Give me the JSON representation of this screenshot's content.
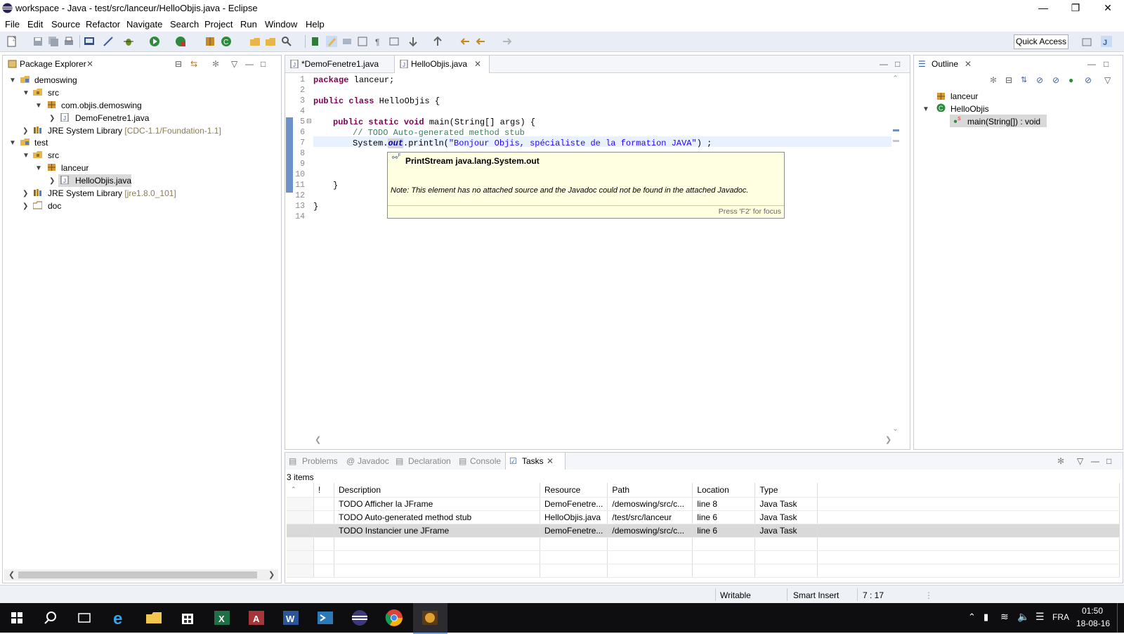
{
  "window": {
    "title": "workspace - Java - test/src/lanceur/HelloObjis.java - Eclipse"
  },
  "menubar": [
    "File",
    "Edit",
    "Source",
    "Refactor",
    "Navigate",
    "Search",
    "Project",
    "Run",
    "Window",
    "Help"
  ],
  "toolbar": {
    "quick_access": "Quick Access"
  },
  "package_explorer": {
    "title": "Package Explorer",
    "nodes": [
      {
        "label": "demoswing"
      },
      {
        "label": "src"
      },
      {
        "label": "com.objis.demoswing"
      },
      {
        "label": "DemoFenetre1.java"
      },
      {
        "label": "JRE System Library",
        "suffix": "[CDC-1.1/Foundation-1.1]"
      },
      {
        "label": "test"
      },
      {
        "label": "src"
      },
      {
        "label": "lanceur"
      },
      {
        "label": "HelloObjis.java"
      },
      {
        "label": "JRE System Library",
        "suffix": "[jre1.8.0_101]"
      },
      {
        "label": "doc"
      }
    ]
  },
  "editor": {
    "tabs": [
      {
        "label": "*DemoFenetre1.java"
      },
      {
        "label": "HelloObjis.java"
      }
    ],
    "line_numbers": [
      "1",
      "2",
      "3",
      "4",
      "5",
      "6",
      "7",
      "8",
      "9",
      "10",
      "11",
      "12",
      "13",
      "14"
    ],
    "code": {
      "l1_kw": "package",
      "l1_rest": " lanceur;",
      "l3_kw": "public class",
      "l3_rest": " HelloObjis {",
      "l5_kw": "public static void",
      "l5_rest": " main(String[] args) {",
      "l6": "// TODO Auto-generated method stub",
      "l7_a": "System.",
      "l7_field": "out",
      "l7_b": ".println(",
      "l7_str": "\"Bonjour Objis, spécialiste de la formation JAVA\"",
      "l7_c": ") ;",
      "l11": "}",
      "l13": "}"
    },
    "tooltip": {
      "title": "PrintStream java.lang.System.out",
      "note": "Note: This element has no attached source and the Javadoc could not be found in the attached Javadoc.",
      "footer": "Press 'F2' for focus"
    }
  },
  "outline": {
    "title": "Outline",
    "items": [
      {
        "label": "lanceur"
      },
      {
        "label": "HelloObjis"
      },
      {
        "label": "main(String[]) : void"
      }
    ]
  },
  "bottom_panel": {
    "tabs": [
      "Problems",
      "Javadoc",
      "Declaration",
      "Console",
      "Tasks"
    ],
    "count": "3 items",
    "columns": [
      "!",
      "Description",
      "Resource",
      "Path",
      "Location",
      "Type"
    ],
    "rows": [
      {
        "description": "TODO Afficher la JFrame",
        "resource": "DemoFenetre...",
        "path": "/demoswing/src/c...",
        "location": "line 8",
        "type": "Java Task"
      },
      {
        "description": "TODO Auto-generated method stub",
        "resource": "HelloObjis.java",
        "path": "/test/src/lanceur",
        "location": "line 6",
        "type": "Java Task"
      },
      {
        "description": "TODO Instancier une JFrame",
        "resource": "DemoFenetre...",
        "path": "/demoswing/src/c...",
        "location": "line 6",
        "type": "Java Task"
      }
    ]
  },
  "statusbar": {
    "writable": "Writable",
    "insert_mode": "Smart Insert",
    "position": "7 : 17"
  },
  "taskbar": {
    "language": "FRA",
    "time": "01:50",
    "date": "18-08-16"
  }
}
